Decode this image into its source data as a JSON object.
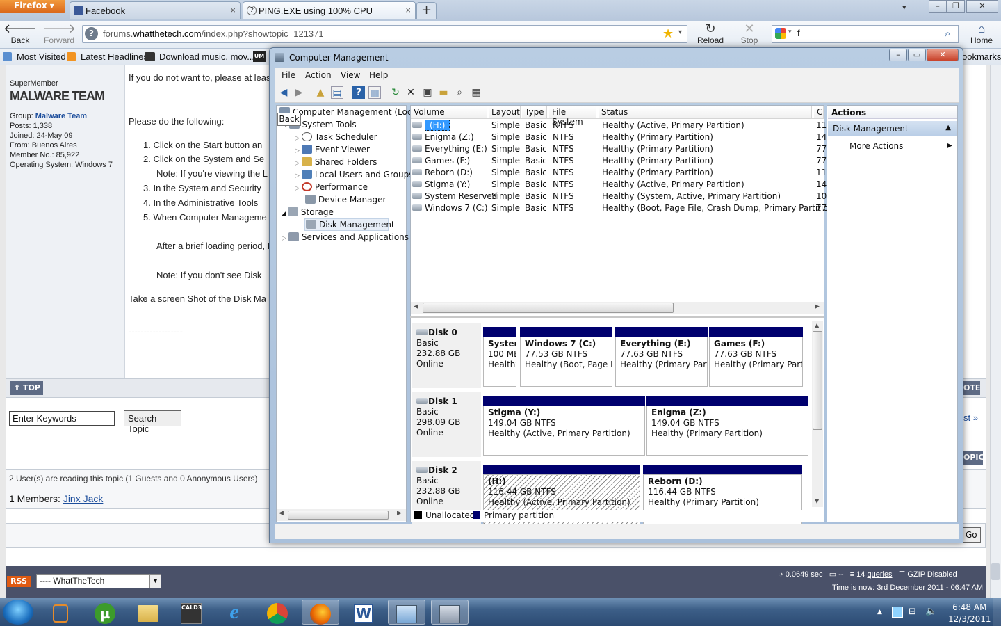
{
  "browser": {
    "menu_button": "Firefox",
    "tabs": [
      {
        "label": "Facebook",
        "active": false
      },
      {
        "label": "PING.EXE using 100% CPU",
        "active": true
      }
    ],
    "nav": {
      "back": "Back",
      "forward": "Forward",
      "reload": "Reload",
      "stop": "Stop",
      "home": "Home"
    },
    "url_prefix": "forums.",
    "url_domain": "whatthetech.com",
    "url_path": "/index.php?showtopic=121371",
    "search_value": "f",
    "bookmarks": [
      "Most Visited",
      "Latest Headlines",
      "Download music, mov...",
      "ookmarks"
    ]
  },
  "forum": {
    "member": {
      "rank": "SuperMember",
      "team_banner": "MALWARE TEAM",
      "group_label": "Group:",
      "group": "Malware Team",
      "posts": "Posts: 1,338",
      "joined": "Joined: 24-May 09",
      "from": "From: Buenos Aires",
      "member_no": "Member No.: 85,922",
      "os": "Operating System: Windows 7"
    },
    "post_lines": [
      "If you do not want to, please at leas",
      "Please do the following:",
      "1.  Click on the Start button an",
      "2.  Click on the System and Se",
      "Note: If you're viewing the L",
      "3.  In the System and Security",
      "4.  In the Administrative Tools",
      "5.  When Computer Manageme",
      "After a brief loading period, D",
      "Note: If you don't see Disk",
      "Take a screen Shot of the Disk Ma",
      "------------------"
    ],
    "top_button": "TOP",
    "search_placeholder": "Enter Keywords",
    "search_button": "Search Topic",
    "reading": "2 User(s) are reading this topic (1 Guests and 0 Anonymous Users)",
    "members_label": "1 Members:",
    "member_name": "Jinx Jack",
    "right_fragments": {
      "ote": "OTE",
      "st": "st »",
      "opic": "OPIC",
      "go": "Go"
    },
    "rss": "RSS",
    "jump_select": "---- WhatTheTech",
    "stats": {
      "time": "0.0649 sec",
      "dash": "--",
      "queries_count": "14",
      "queries": "queries",
      "gzip": "GZIP Disabled",
      "time_now": "Time is now: 3rd December 2011 - 06:47 AM"
    }
  },
  "computer_management": {
    "title": "Computer Management",
    "menu": [
      "File",
      "Action",
      "View",
      "Help"
    ],
    "tooltip": "Back",
    "tree": {
      "root": "Computer Management (Local",
      "system_tools": "System Tools",
      "task_scheduler": "Task Scheduler",
      "event_viewer": "Event Viewer",
      "shared_folders": "Shared Folders",
      "local_users": "Local Users and Groups",
      "performance": "Performance",
      "device_manager": "Device Manager",
      "storage": "Storage",
      "disk_management": "Disk Management",
      "services": "Services and Applications"
    },
    "columns": [
      "Volume",
      "Layout",
      "Type",
      "File System",
      "Status",
      "C"
    ],
    "volumes": [
      {
        "volume": "(H:)",
        "layout": "Simple",
        "type": "Basic",
        "fs": "NTFS",
        "status": "Healthy (Active, Primary Partition)",
        "cap": "11"
      },
      {
        "volume": "Enigma (Z:)",
        "layout": "Simple",
        "type": "Basic",
        "fs": "NTFS",
        "status": "Healthy (Primary Partition)",
        "cap": "14"
      },
      {
        "volume": "Everything (E:)",
        "layout": "Simple",
        "type": "Basic",
        "fs": "NTFS",
        "status": "Healthy (Primary Partition)",
        "cap": "77"
      },
      {
        "volume": "Games (F:)",
        "layout": "Simple",
        "type": "Basic",
        "fs": "NTFS",
        "status": "Healthy (Primary Partition)",
        "cap": "77"
      },
      {
        "volume": "Reborn (D:)",
        "layout": "Simple",
        "type": "Basic",
        "fs": "NTFS",
        "status": "Healthy (Primary Partition)",
        "cap": "11"
      },
      {
        "volume": "Stigma (Y:)",
        "layout": "Simple",
        "type": "Basic",
        "fs": "NTFS",
        "status": "Healthy (Active, Primary Partition)",
        "cap": "14"
      },
      {
        "volume": "System Reserved",
        "layout": "Simple",
        "type": "Basic",
        "fs": "NTFS",
        "status": "Healthy (System, Active, Primary Partition)",
        "cap": "10"
      },
      {
        "volume": "Windows 7 (C:)",
        "layout": "Simple",
        "type": "Basic",
        "fs": "NTFS",
        "status": "Healthy (Boot, Page File, Crash Dump, Primary Partition)",
        "cap": "77"
      }
    ],
    "disks": [
      {
        "name": "Disk 0",
        "type": "Basic",
        "size": "232.88 GB",
        "state": "Online",
        "partitions": [
          {
            "name": "System",
            "size": "100 MB",
            "status": "Healthy"
          },
          {
            "name": "Windows 7  (C:)",
            "size": "77.53 GB NTFS",
            "status": "Healthy (Boot, Page Fil"
          },
          {
            "name": "Everything  (E:)",
            "size": "77.63 GB NTFS",
            "status": "Healthy (Primary Partit"
          },
          {
            "name": "Games  (F:)",
            "size": "77.63 GB NTFS",
            "status": "Healthy (Primary Partit"
          }
        ]
      },
      {
        "name": "Disk 1",
        "type": "Basic",
        "size": "298.09 GB",
        "state": "Online",
        "partitions": [
          {
            "name": "Stigma  (Y:)",
            "size": "149.04 GB NTFS",
            "status": "Healthy (Active, Primary Partition)"
          },
          {
            "name": "Enigma  (Z:)",
            "size": "149.04 GB NTFS",
            "status": "Healthy (Primary Partition)"
          }
        ]
      },
      {
        "name": "Disk 2",
        "type": "Basic",
        "size": "232.88 GB",
        "state": "Online",
        "partitions": [
          {
            "name": "(H:)",
            "size": "116.44 GB NTFS",
            "status": "Healthy (Active, Primary Partition)"
          },
          {
            "name": "Reborn  (D:)",
            "size": "116.44 GB NTFS",
            "status": "Healthy (Primary Partition)"
          }
        ]
      }
    ],
    "legend": {
      "unallocated": "Unallocated",
      "primary": "Primary partition"
    },
    "actions": {
      "header": "Actions",
      "section": "Disk Management",
      "more": "More Actions"
    }
  },
  "taskbar": {
    "clock_time": "6:48 AM",
    "clock_date": "12/3/2011",
    "cald3": "CALD3"
  },
  "colors": {
    "partition_bar": "#00006e",
    "selection": "#3399ff",
    "actions_header": "#b8cde6"
  }
}
